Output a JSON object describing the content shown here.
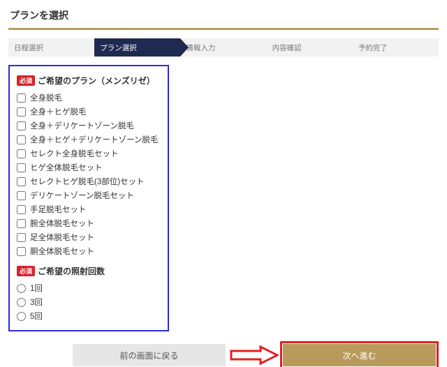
{
  "page": {
    "title": "プランを選択"
  },
  "stepper": {
    "active": 1,
    "steps": [
      {
        "label": "日程選択"
      },
      {
        "label": "プラン選択"
      },
      {
        "label": "情報入力"
      },
      {
        "label": "内容確認"
      },
      {
        "label": "予約完了"
      }
    ]
  },
  "sections": {
    "required_badge": "必須",
    "plan": {
      "title": "ご希望のプラン（メンズリゼ）",
      "options": [
        "全身脱毛",
        "全身＋ヒゲ脱毛",
        "全身＋デリケートゾーン脱毛",
        "全身＋ヒゲ＋デリケートゾーン脱毛",
        "セレクト全身脱毛セット",
        "ヒゲ全体脱毛セット",
        "セレクトヒゲ脱毛(3部位)セット",
        "デリケートゾーン脱毛セット",
        "手足脱毛セット",
        "腕全体脱毛セット",
        "足全体脱毛セット",
        "胴全体脱毛セット"
      ]
    },
    "sessions": {
      "title": "ご希望の照射回数",
      "options": [
        "1回",
        "3回",
        "5回"
      ]
    }
  },
  "buttons": {
    "back": "前の画面に戻る",
    "next": "次へ進む"
  },
  "colors": {
    "accent_gold": "#b89a5a",
    "stepper_active": "#1f2a50",
    "highlight_box": "#2a2adf",
    "annotation_red": "#e02020"
  }
}
